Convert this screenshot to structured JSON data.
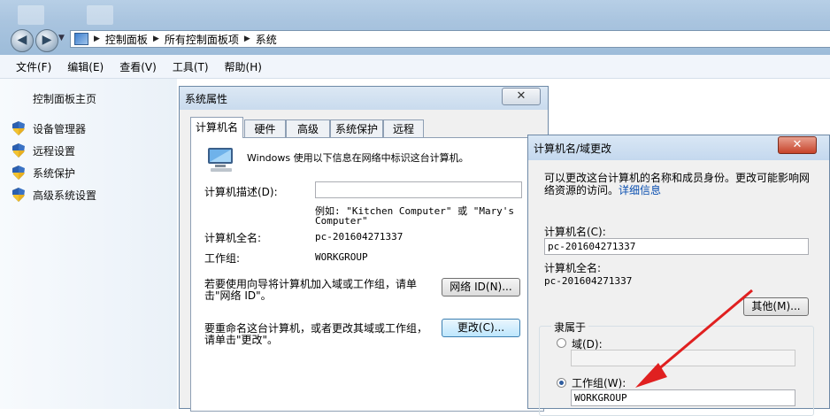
{
  "address": {
    "crumbs": [
      "控制面板",
      "所有控制面板项",
      "系统"
    ]
  },
  "menu": [
    "文件(F)",
    "编辑(E)",
    "查看(V)",
    "工具(T)",
    "帮助(H)"
  ],
  "leftnav": {
    "home": "控制面板主页",
    "links": [
      "设备管理器",
      "远程设置",
      "系统保护",
      "高级系统设置"
    ]
  },
  "sysprops": {
    "title": "系统属性",
    "close": "✕",
    "tabs": [
      "计算机名",
      "硬件",
      "高级",
      "系统保护",
      "远程"
    ],
    "intro": "Windows 使用以下信息在网络中标识这台计算机。",
    "desc_label": "计算机描述(D):",
    "desc_value": "",
    "example_line1": "例如: \"Kitchen Computer\" 或 \"Mary's",
    "example_line2": "Computer\"",
    "fullname_label": "计算机全名:",
    "fullname_value": "pc-201604271337",
    "workgroup_label": "工作组:",
    "workgroup_value": "WORKGROUP",
    "wizard_text_1": "若要使用向导将计算机加入域或工作组，请单",
    "wizard_text_2": "击\"网络 ID\"。",
    "network_id_button": "网络 ID(N)...",
    "rename_text_1": "要重命名这台计算机，或者更改其域或工作组，",
    "rename_text_2": "请单击\"更改\"。",
    "change_button": "更改(C)..."
  },
  "compname": {
    "title": "计算机名/域更改",
    "close": "✕",
    "info_text_1": "可以更改这台计算机的名称和成员身份。更改可能影响网",
    "info_text_2": "络资源的访问。",
    "info_link": "详细信息",
    "name_label": "计算机名(C):",
    "name_value": "pc-201604271337",
    "fullname_label": "计算机全名:",
    "fullname_value": "pc-201604271337",
    "other_button": "其他(M)...",
    "member_of": "隶属于",
    "domain_label": "域(D):",
    "domain_value": "",
    "workgroup_label": "工作组(W):",
    "workgroup_value": "WORKGROUP"
  },
  "colors": {
    "arrow": "#e02020",
    "link": "#0a4fb0",
    "titlebar": "#a9c4df"
  }
}
